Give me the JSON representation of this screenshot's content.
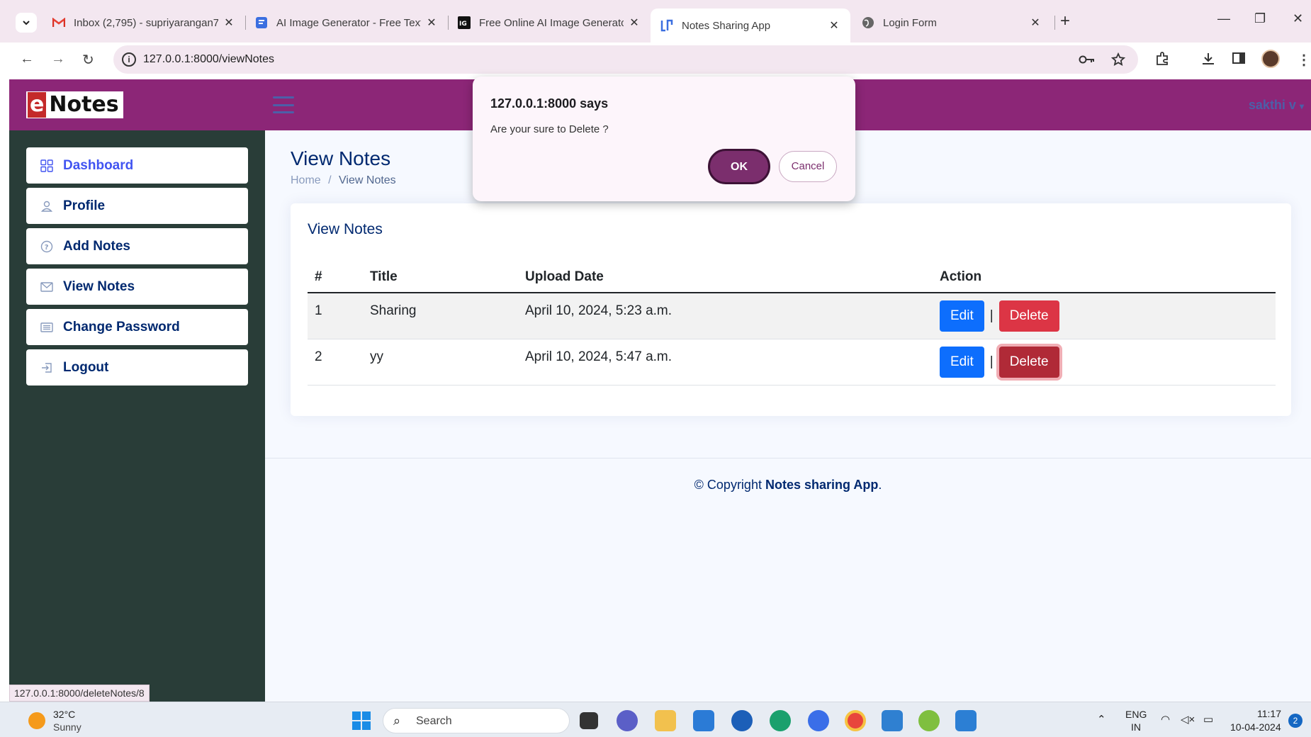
{
  "browser": {
    "tabs": [
      {
        "title": "Inbox (2,795) - supriyarangan7",
        "favicon": "gmail-icon"
      },
      {
        "title": "AI Image Generator - Free Text t",
        "favicon": "forms-icon"
      },
      {
        "title": "Free Online AI Image Generator",
        "favicon": "ig-icon"
      },
      {
        "title": "Notes Sharing App",
        "favicon": "notes-app-icon",
        "active": true
      },
      {
        "title": "Login Form",
        "favicon": "globe-icon"
      }
    ],
    "url": "127.0.0.1:8000/viewNotes",
    "status_url": "127.0.0.1:8000/deleteNotes/8"
  },
  "header": {
    "logo_letter": "e",
    "logo_text": "Notes",
    "user": "sakthi v"
  },
  "sidebar": {
    "items": [
      {
        "label": "Dashboard",
        "icon": "grid-icon"
      },
      {
        "label": "Profile",
        "icon": "person-icon"
      },
      {
        "label": "Add Notes",
        "icon": "question-circle-icon"
      },
      {
        "label": "View Notes",
        "icon": "envelope-icon"
      },
      {
        "label": "Change Password",
        "icon": "card-list-icon"
      },
      {
        "label": "Logout",
        "icon": "box-arrow-in-left-icon"
      }
    ]
  },
  "main": {
    "page_title": "View Notes",
    "breadcrumb": {
      "home": "Home",
      "sep": "/",
      "current": "View Notes"
    },
    "card_title": "View Notes",
    "table": {
      "headers": [
        "#",
        "Title",
        "Upload Date",
        "Action"
      ],
      "rows": [
        {
          "num": "1",
          "title": "Sharing",
          "date": "April 10, 2024, 5:23 a.m."
        },
        {
          "num": "2",
          "title": "yy",
          "date": "April 10, 2024, 5:47 a.m."
        }
      ],
      "edit_label": "Edit",
      "delete_label": "Delete",
      "separator": "|"
    },
    "footer": {
      "prefix": "© Copyright ",
      "brand": "Notes sharing App",
      "suffix": "."
    }
  },
  "dialog": {
    "title": "127.0.0.1:8000 says",
    "message": "Are your sure to Delete ?",
    "ok": "OK",
    "cancel": "Cancel"
  },
  "taskbar": {
    "temperature": "32°C",
    "weather": "Sunny",
    "search": "Search",
    "lang_1": "ENG",
    "lang_2": "IN",
    "time": "11:17",
    "date": "10-04-2024",
    "notifications": "2"
  },
  "colors": {
    "header": "#8c2677",
    "sidebar": "#293d38",
    "edit": "#0d6efd",
    "delete": "#dc3545",
    "dialog_ok": "#7b2e6d"
  }
}
